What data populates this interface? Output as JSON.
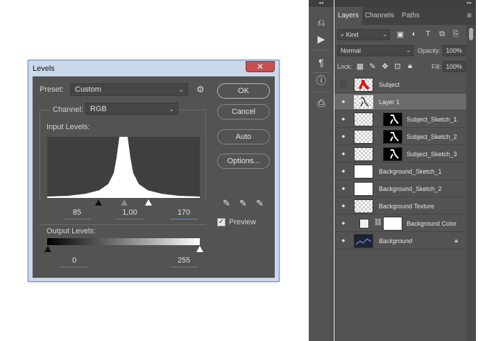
{
  "levels_dialog": {
    "title": "Levels",
    "close_glyph": "✕",
    "preset_label": "Preset:",
    "preset_value": "Custom",
    "channel_label": "Channel:",
    "channel_value": "RGB",
    "input_levels_label": "Input Levels:",
    "input_black": "85",
    "input_gamma": "1,00",
    "input_white": "170",
    "output_levels_label": "Output Levels:",
    "output_black": "0",
    "output_white": "255",
    "buttons": {
      "ok": "OK",
      "cancel": "Cancel",
      "auto": "Auto",
      "options": "Options..."
    },
    "preview_label": "Preview",
    "preview_checked": true
  },
  "layers_panel": {
    "tabs": [
      "Layers",
      "Channels",
      "Paths"
    ],
    "active_tab": "Layers",
    "kind_filter": "Kind",
    "blend_mode": "Normal",
    "opacity_label": "Opacity:",
    "opacity_value": "100%",
    "lock_label": "Lock:",
    "fill_label": "Fill:",
    "fill_value": "100%",
    "layers": [
      {
        "name": "Subject",
        "visible": false,
        "thumb": "red-figure",
        "indent": false
      },
      {
        "name": "Layer 1",
        "visible": true,
        "thumb": "checker",
        "selected": true,
        "indent": false
      },
      {
        "name": "Subject_Sketch_1",
        "visible": true,
        "thumb": "checker",
        "mask": true,
        "indent": true
      },
      {
        "name": "Subject_Sketch_2",
        "visible": true,
        "thumb": "checker",
        "mask": true,
        "indent": true
      },
      {
        "name": "Subject_Sketch_3",
        "visible": true,
        "thumb": "checker",
        "mask": true,
        "indent": true
      },
      {
        "name": "Background_Sketch_1",
        "visible": true,
        "thumb": "white",
        "indent": false
      },
      {
        "name": "Background_Sketch_2",
        "visible": true,
        "thumb": "white",
        "indent": false
      },
      {
        "name": "Background Texture",
        "visible": true,
        "thumb": "checker",
        "indent": false
      },
      {
        "name": "Background Color",
        "visible": true,
        "thumb": "fill",
        "indent": false
      },
      {
        "name": "Background",
        "visible": true,
        "thumb": "dark",
        "locked": true,
        "italic": true,
        "indent": false
      }
    ]
  },
  "colors": {
    "panel_bg": "#535353",
    "dialog_frame": "#c9d9ea",
    "close_red": "#c75050",
    "accent_blue": "#4a90d9"
  }
}
